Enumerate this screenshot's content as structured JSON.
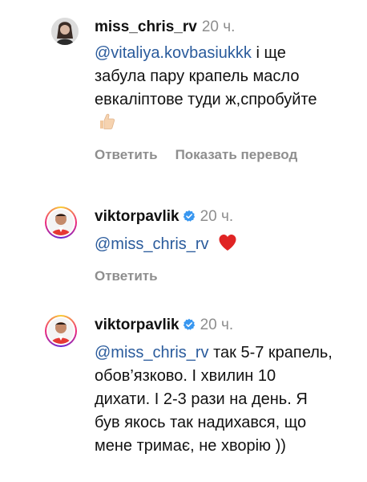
{
  "comments": [
    {
      "username": "miss_chris_rv",
      "verified": false,
      "time": "20 ч.",
      "mention": "@vitaliya.kovbasiukkk",
      "text": " і ще забула пару крапель масло евкаліптове туди ж,спробуйте ",
      "emoji": "thumbs-up-icon",
      "actions": [
        "Ответить",
        "Показать перевод"
      ]
    },
    {
      "username": "viktorpavlik",
      "verified": true,
      "time": "20 ч.",
      "mention": "@miss_chris_rv",
      "text": " ",
      "emoji": "red-heart-icon",
      "actions": [
        "Ответить"
      ]
    },
    {
      "username": "viktorpavlik",
      "verified": true,
      "time": "20 ч.",
      "mention": "@miss_chris_rv",
      "text": " так 5-7 крапель, обов’язково. І хвилин 10 дихати. І 2-3 рази на день. Я був якось так надихався, що мене тримає, не хворію ))",
      "emoji": "",
      "actions": []
    }
  ],
  "colors": {
    "mention": "#2a5b9c",
    "muted": "#8e8e8e",
    "verified": "#3897f0"
  }
}
